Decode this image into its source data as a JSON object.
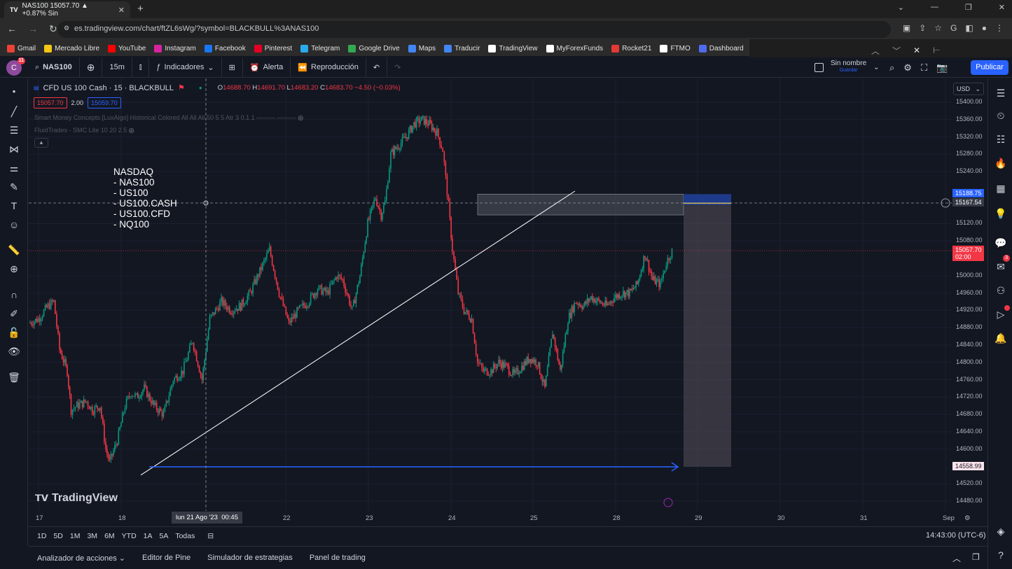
{
  "browser": {
    "tab_title": "NAS100 15057.70 ▲ +0.87% Sin",
    "tab_icon": "tradingview-icon",
    "new_tab": "+",
    "url": "es.tradingview.com/chart/ftZL6sWg/?symbol=BLACKBULL%3ANAS100",
    "bookmarks": [
      "Gmail",
      "Mercado Libre",
      "YouTube",
      "Instagram",
      "Facebook",
      "Pinterest",
      "Telegram",
      "Google Drive",
      "Maps",
      "Traducir",
      "TradingView",
      "MyForexFunds",
      "Rocket21",
      "FTMO",
      "Dashboard"
    ],
    "bookmark_colors": [
      "#ea4335",
      "#f5c518",
      "#ff0000",
      "#d6249f",
      "#1877f2",
      "#e60023",
      "#2aabee",
      "#34a853",
      "#4285f4",
      "#4285f4",
      "#ffffff",
      "#ffffff",
      "#e53935",
      "#ffffff",
      "#4f6bed"
    ]
  },
  "toolbar": {
    "avatar_letter": "C",
    "avatar_badge": "11",
    "symbol": "NAS100",
    "interval": "15m",
    "indicators": "Indicadores",
    "alert": "Alerta",
    "replay": "Reproducción",
    "layout_name": "Sin nombre",
    "layout_sub": "Guardar",
    "publish": "Publicar"
  },
  "legend": {
    "title": "CFD US 100 Cash · 15 · BLACKBULL",
    "o_label": "O",
    "o": "14688.70",
    "h_label": "H",
    "h": "14691.70",
    "l_label": "L",
    "l": "14683.20",
    "c_label": "C",
    "c": "14683.70",
    "change": "−4.50 (−0.03%)",
    "sell": "15057.70",
    "spread": "2.00",
    "buy": "15059.70",
    "indicator1": "Smart Money Concepts [LuxAlgo] Historical Colored All All All 50 5 5 Atr 3 0.1 1 ——— ———",
    "indicator2": "FluidTrades - SMC Lite 10 20 2.5"
  },
  "annotation_text": "NASDAQ\n- NAS100\n- US100\n- US100.CASH\n- US100.CFD\n- NQ100",
  "currency": "USD",
  "chart_data": {
    "type": "line",
    "title": "CFD US 100 Cash · 15 · BLACKBULL",
    "x": [
      "17",
      "18",
      "21",
      "22",
      "23",
      "24",
      "25",
      "28",
      "28"
    ],
    "y_label": "",
    "ylim": [
      14460,
      15420
    ],
    "y_ticks": [
      "15400.00",
      "15360.00",
      "15320.00",
      "15280.00",
      "15240.00",
      "15120.00",
      "15080.00",
      "15000.00",
      "14960.00",
      "14920.00",
      "14880.00",
      "14840.00",
      "14800.00",
      "14760.00",
      "14720.00",
      "14680.00",
      "14640.00",
      "14600.00",
      "14520.00",
      "14480.00"
    ],
    "x_ticks": [
      "17",
      "18",
      "22",
      "23",
      "24",
      "25",
      "28",
      "29",
      "30",
      "31",
      "Sep"
    ],
    "crosshair_x_label": "lun 21 Ago '23",
    "crosshair_time": "00:45",
    "price_tags": {
      "zone_top": "15188.75",
      "crosshair": "15167.54",
      "last": "15057.70",
      "countdown": "02:00",
      "target": "14558.99"
    },
    "series": [
      {
        "name": "NAS100",
        "points": [
          [
            0,
            14890
          ],
          [
            0.5,
            14900
          ],
          [
            1,
            14930
          ],
          [
            1.3,
            14940
          ],
          [
            1.6,
            14830
          ],
          [
            2,
            14780
          ],
          [
            2.2,
            14690
          ],
          [
            2.5,
            14700
          ],
          [
            3,
            14710
          ],
          [
            3.3,
            14690
          ],
          [
            3.7,
            14700
          ],
          [
            4,
            14600
          ],
          [
            4.2,
            14570
          ],
          [
            4.6,
            14620
          ],
          [
            5,
            14700
          ],
          [
            5.3,
            14730
          ],
          [
            5.6,
            14720
          ],
          [
            6,
            14740
          ],
          [
            6.5,
            14700
          ],
          [
            7,
            14680
          ],
          [
            7.5,
            14760
          ],
          [
            8,
            14780
          ],
          [
            8.5,
            14850
          ],
          [
            9,
            14760
          ],
          [
            9.4,
            14900
          ],
          [
            10,
            14940
          ],
          [
            10.5,
            14920
          ],
          [
            11,
            14930
          ],
          [
            11.5,
            14960
          ],
          [
            12,
            15010
          ],
          [
            12.5,
            15060
          ],
          [
            13,
            14960
          ],
          [
            13.5,
            14890
          ],
          [
            14,
            14920
          ],
          [
            14.5,
            14940
          ],
          [
            15,
            14970
          ],
          [
            15.5,
            14960
          ],
          [
            16,
            15000
          ],
          [
            16.3,
            14990
          ],
          [
            16.8,
            14920
          ],
          [
            17.2,
            15000
          ],
          [
            17.6,
            15120
          ],
          [
            18,
            15180
          ],
          [
            18.3,
            15140
          ],
          [
            18.5,
            15170
          ],
          [
            18.8,
            15280
          ],
          [
            19.2,
            15300
          ],
          [
            19.6,
            15320
          ],
          [
            20,
            15350
          ],
          [
            20.4,
            15360
          ],
          [
            20.8,
            15350
          ],
          [
            21.2,
            15330
          ],
          [
            21.5,
            15290
          ],
          [
            21.8,
            15160
          ],
          [
            22,
            15060
          ],
          [
            22.3,
            14960
          ],
          [
            22.6,
            14920
          ],
          [
            23,
            14900
          ],
          [
            23.3,
            14800
          ],
          [
            23.6,
            14780
          ],
          [
            24,
            14780
          ],
          [
            24.4,
            14800
          ],
          [
            24.8,
            14790
          ],
          [
            25.2,
            14770
          ],
          [
            25.6,
            14790
          ],
          [
            26,
            14810
          ],
          [
            26.4,
            14800
          ],
          [
            26.8,
            14740
          ],
          [
            27.2,
            14870
          ],
          [
            27.6,
            14780
          ],
          [
            28,
            14900
          ],
          [
            28.4,
            14940
          ],
          [
            28.8,
            14930
          ],
          [
            29.2,
            14950
          ],
          [
            29.6,
            14940
          ],
          [
            30,
            14930
          ],
          [
            30.4,
            14950
          ],
          [
            30.8,
            14960
          ],
          [
            31.2,
            14960
          ],
          [
            31.6,
            14980
          ],
          [
            32,
            15050
          ],
          [
            32.4,
            14990
          ],
          [
            32.8,
            14980
          ],
          [
            33.1,
            15030
          ],
          [
            33.4,
            15057
          ]
        ]
      }
    ],
    "zones": {
      "supply_top": 15188,
      "supply_bottom": 15140,
      "target": 14559
    }
  },
  "xaxis_labels": [
    "17",
    "18",
    "22",
    "23",
    "24",
    "25",
    "28",
    "29",
    "30",
    "31",
    "Sep"
  ],
  "ranges": [
    "1D",
    "5D",
    "1M",
    "3M",
    "6M",
    "YTD",
    "1A",
    "5A",
    "Todas"
  ],
  "clock": "14:43:00 (UTC-6)",
  "bottom_tabs": [
    "Analizador de acciones",
    "Editor de Pine",
    "Simulador de estrategias",
    "Panel de trading"
  ],
  "brand": "TradingView",
  "right_badge": "3"
}
